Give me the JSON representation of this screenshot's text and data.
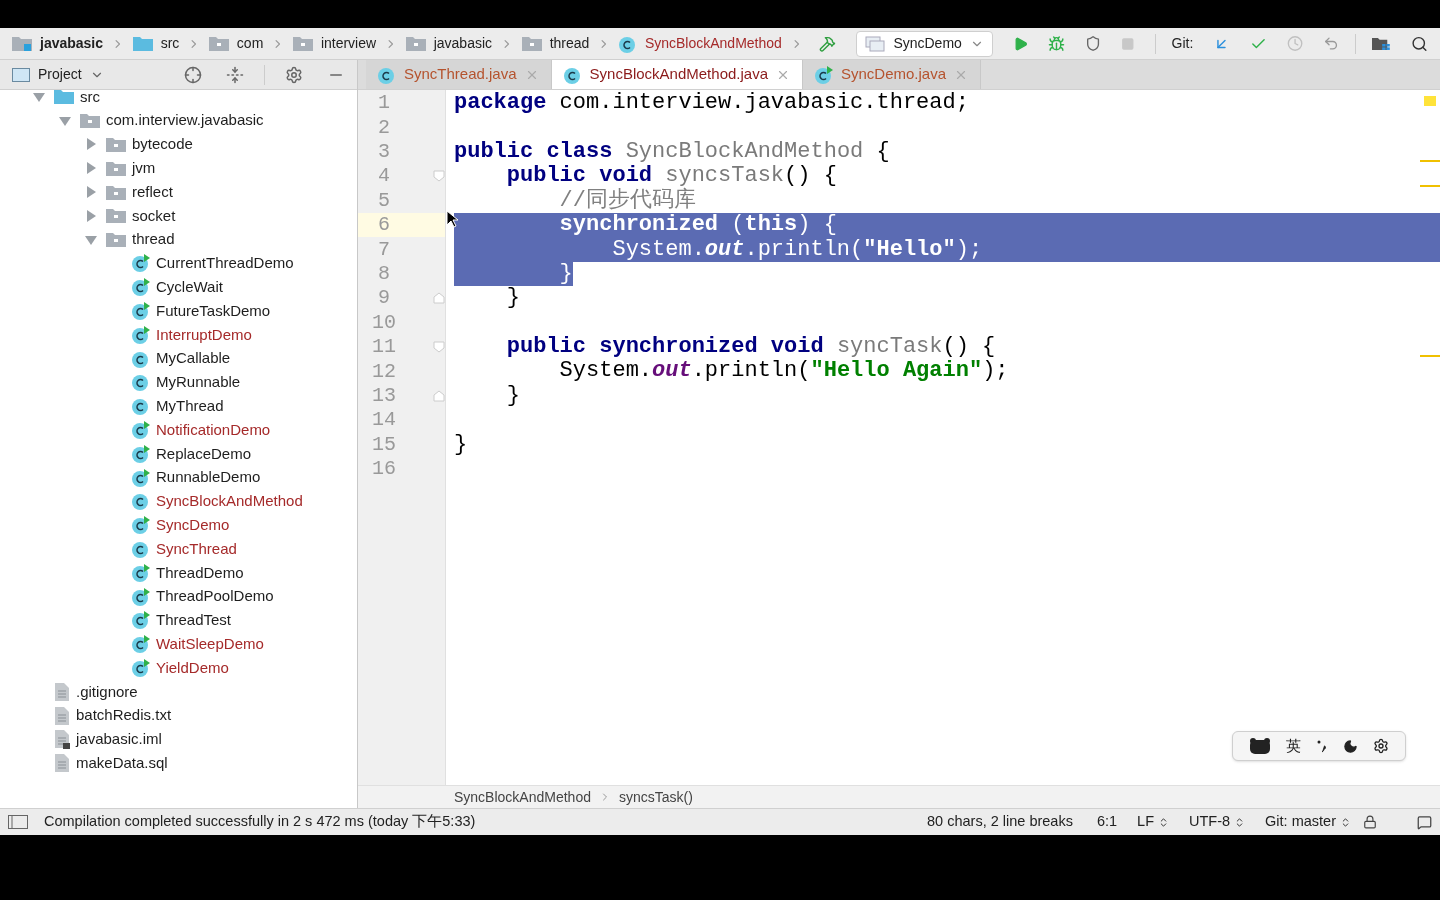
{
  "nav_bar": {
    "breadcrumbs": [
      {
        "label": "javabasic",
        "kind": "module",
        "modified": false
      },
      {
        "label": "src",
        "kind": "source_folder",
        "modified": false
      },
      {
        "label": "com",
        "kind": "package",
        "modified": false
      },
      {
        "label": "interview",
        "kind": "package",
        "modified": false
      },
      {
        "label": "javabasic",
        "kind": "package",
        "modified": false
      },
      {
        "label": "thread",
        "kind": "package",
        "modified": false
      },
      {
        "label": "SyncBlockAndMethod",
        "kind": "class",
        "modified": true
      }
    ],
    "run_config": "SyncDemo",
    "git_label": "Git:"
  },
  "project_panel": {
    "title": "Project",
    "tree": [
      {
        "label": "src",
        "kind": "source_folder",
        "expanded": true,
        "children": [
          {
            "label": "com.interview.javabasic",
            "kind": "package",
            "expanded": true,
            "children": [
              {
                "label": "bytecode",
                "kind": "package",
                "expanded": false
              },
              {
                "label": "jvm",
                "kind": "package",
                "expanded": false
              },
              {
                "label": "reflect",
                "kind": "package",
                "expanded": false
              },
              {
                "label": "socket",
                "kind": "package",
                "expanded": false
              },
              {
                "label": "thread",
                "kind": "package",
                "expanded": true,
                "children": [
                  {
                    "label": "CurrentThreadDemo",
                    "kind": "runnable",
                    "modified": false
                  },
                  {
                    "label": "CycleWait",
                    "kind": "runnable",
                    "modified": false
                  },
                  {
                    "label": "FutureTaskDemo",
                    "kind": "runnable",
                    "modified": false
                  },
                  {
                    "label": "InterruptDemo",
                    "kind": "runnable",
                    "modified": true
                  },
                  {
                    "label": "MyCallable",
                    "kind": "class",
                    "modified": false
                  },
                  {
                    "label": "MyRunnable",
                    "kind": "class",
                    "modified": false
                  },
                  {
                    "label": "MyThread",
                    "kind": "class",
                    "modified": false
                  },
                  {
                    "label": "NotificationDemo",
                    "kind": "runnable",
                    "modified": true
                  },
                  {
                    "label": "ReplaceDemo",
                    "kind": "runnable",
                    "modified": false
                  },
                  {
                    "label": "RunnableDemo",
                    "kind": "runnable",
                    "modified": false
                  },
                  {
                    "label": "SyncBlockAndMethod",
                    "kind": "class",
                    "modified": true
                  },
                  {
                    "label": "SyncDemo",
                    "kind": "runnable",
                    "modified": true
                  },
                  {
                    "label": "SyncThread",
                    "kind": "class",
                    "modified": true
                  },
                  {
                    "label": "ThreadDemo",
                    "kind": "runnable",
                    "modified": false
                  },
                  {
                    "label": "ThreadPoolDemo",
                    "kind": "runnable",
                    "modified": false
                  },
                  {
                    "label": "ThreadTest",
                    "kind": "runnable",
                    "modified": false
                  },
                  {
                    "label": "WaitSleepDemo",
                    "kind": "runnable",
                    "modified": true
                  },
                  {
                    "label": "YieldDemo",
                    "kind": "runnable",
                    "modified": true
                  }
                ]
              }
            ]
          }
        ]
      },
      {
        "label": ".gitignore",
        "kind": "file",
        "modified": false
      },
      {
        "label": "batchRedis.txt",
        "kind": "file",
        "modified": false
      },
      {
        "label": "javabasic.iml",
        "kind": "iml",
        "modified": false
      },
      {
        "label": "makeData.sql",
        "kind": "file",
        "modified": false
      }
    ]
  },
  "tabs": [
    {
      "label": "SyncThread.java",
      "kind": "class",
      "modified": true,
      "selected": false
    },
    {
      "label": "SyncBlockAndMethod.java",
      "kind": "class",
      "modified": true,
      "selected": true
    },
    {
      "label": "SyncDemo.java",
      "kind": "runnable",
      "modified": true,
      "selected": false
    }
  ],
  "editor": {
    "lines": [
      {
        "number": "1",
        "selected": false,
        "current": false,
        "fold_start": false,
        "fold_end": false,
        "tokens": [
          {
            "kind": "kw",
            "text": "package"
          },
          {
            "kind": "plain",
            "text": " com.interview.javabasic.thread;"
          }
        ]
      },
      {
        "number": "2",
        "selected": false,
        "current": false,
        "fold_start": false,
        "fold_end": false
      },
      {
        "number": "3",
        "selected": false,
        "current": false,
        "fold_start": false,
        "fold_end": false,
        "tokens": [
          {
            "kind": "kw",
            "text": "public class "
          },
          {
            "kind": "decl",
            "text": "SyncBlockAndMethod"
          },
          {
            "kind": "plain",
            "text": " {"
          }
        ]
      },
      {
        "number": "4",
        "selected": false,
        "current": false,
        "fold_start": true,
        "fold_end": false,
        "tokens": [
          {
            "kind": "kw",
            "text": "    public void "
          },
          {
            "kind": "decl",
            "text": "syncsTask"
          },
          {
            "kind": "plain",
            "text": "() {"
          }
        ]
      },
      {
        "number": "5",
        "selected": false,
        "current": false,
        "fold_start": false,
        "fold_end": false,
        "tokens": [
          {
            "kind": "comment",
            "text": "        //同步代码库"
          }
        ]
      },
      {
        "number": "6",
        "selected": true,
        "current": true,
        "fold_start": false,
        "fold_end": false,
        "tokens": [
          {
            "kind": "kw",
            "text": "        synchronized"
          },
          {
            "kind": "plain",
            "text": " ("
          },
          {
            "kind": "kw",
            "text": "this"
          },
          {
            "kind": "plain",
            "text": ") {"
          }
        ]
      },
      {
        "number": "7",
        "selected": true,
        "current": false,
        "fold_start": false,
        "fold_end": false,
        "tokens": [
          {
            "kind": "plain",
            "text": "            System."
          },
          {
            "kind": "field",
            "text": "out"
          },
          {
            "kind": "plain",
            "text": ".println("
          },
          {
            "kind": "str",
            "text": "\"Hello\""
          },
          {
            "kind": "plain",
            "text": ");"
          }
        ]
      },
      {
        "number": "8",
        "selected": true,
        "current": false,
        "fold_start": false,
        "fold_end": false,
        "tokens": [
          {
            "kind": "plain",
            "text": "        }"
          }
        ]
      },
      {
        "number": "9",
        "selected": false,
        "current": false,
        "fold_start": false,
        "fold_end": true,
        "tokens": [
          {
            "kind": "plain",
            "text": "    }"
          }
        ]
      },
      {
        "number": "10",
        "selected": false,
        "current": false,
        "fold_start": false,
        "fold_end": false
      },
      {
        "number": "11",
        "selected": false,
        "current": false,
        "fold_start": true,
        "fold_end": false,
        "tokens": [
          {
            "kind": "kw",
            "text": "    public synchronized void "
          },
          {
            "kind": "decl",
            "text": "syncTask"
          },
          {
            "kind": "plain",
            "text": "() {"
          }
        ]
      },
      {
        "number": "12",
        "selected": false,
        "current": false,
        "fold_start": false,
        "fold_end": false,
        "tokens": [
          {
            "kind": "plain",
            "text": "        System."
          },
          {
            "kind": "field",
            "text": "out"
          },
          {
            "kind": "plain",
            "text": ".println("
          },
          {
            "kind": "str",
            "text": "\"Hello Again\""
          },
          {
            "kind": "plain",
            "text": ");"
          }
        ]
      },
      {
        "number": "13",
        "selected": false,
        "current": false,
        "fold_start": false,
        "fold_end": true,
        "tokens": [
          {
            "kind": "plain",
            "text": "    }"
          }
        ]
      },
      {
        "number": "14",
        "selected": false,
        "current": false,
        "fold_start": false,
        "fold_end": false
      },
      {
        "number": "15",
        "selected": false,
        "current": false,
        "fold_start": false,
        "fold_end": false,
        "tokens": [
          {
            "kind": "plain",
            "text": "}"
          }
        ]
      },
      {
        "number": "16",
        "selected": false,
        "current": false,
        "fold_start": false,
        "fold_end": false
      }
    ],
    "breadcrumbs": [
      "SyncBlockAndMethod",
      "syncsTask()"
    ]
  },
  "input_method_bar": {
    "language": "英"
  },
  "status_bar": {
    "message": "Compilation completed successfully in 2 s 472 ms (today 下午5:33)",
    "selection_info": "80 chars, 2 line breaks",
    "position": "6:1",
    "line_separator": "LF",
    "encoding": "UTF-8",
    "vcs_branch": "Git: master"
  }
}
